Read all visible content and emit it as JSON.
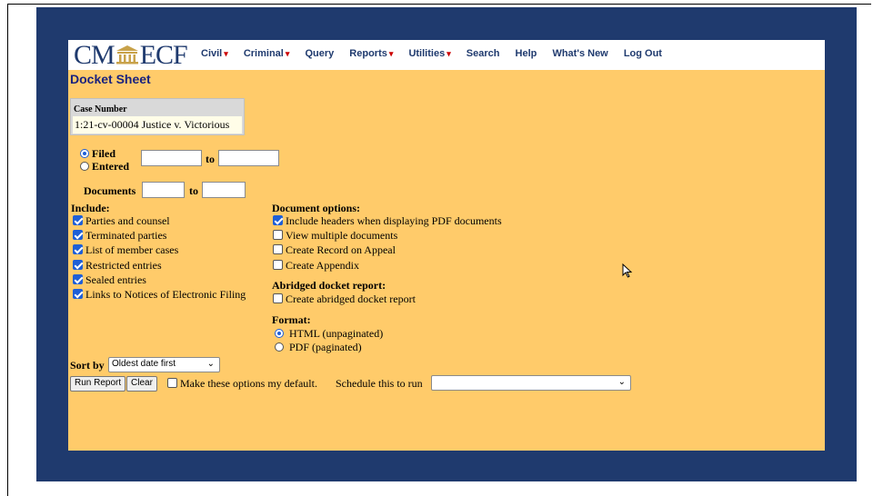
{
  "header": {
    "logo_left": "CM",
    "logo_right": "ECF",
    "menu": [
      {
        "label": "Civil",
        "dropdown": true
      },
      {
        "label": "Criminal",
        "dropdown": true
      },
      {
        "label": "Query",
        "dropdown": false
      },
      {
        "label": "Reports",
        "dropdown": true
      },
      {
        "label": "Utilities",
        "dropdown": true
      },
      {
        "label": "Search",
        "dropdown": false
      },
      {
        "label": "Help",
        "dropdown": false
      },
      {
        "label": "What's New",
        "dropdown": false
      },
      {
        "label": "Log Out",
        "dropdown": false
      }
    ]
  },
  "page_title": "Docket Sheet",
  "case": {
    "label": "Case Number",
    "value": "1:21-cv-00004 Justice v. Victorious"
  },
  "dates": {
    "filed_label": "Filed",
    "entered_label": "Entered",
    "to_label": "to",
    "filed_selected": true
  },
  "documents": {
    "label": "Documents",
    "to_label": "to"
  },
  "include": {
    "heading": "Include:",
    "items": [
      {
        "label": "Parties and counsel",
        "checked": true
      },
      {
        "label": "Terminated parties",
        "checked": true
      },
      {
        "label": "List of member cases",
        "checked": true
      },
      {
        "label": "Restricted entries",
        "checked": true
      },
      {
        "label": "Sealed entries",
        "checked": true
      },
      {
        "label": "Links to Notices of Electronic Filing",
        "checked": true
      }
    ]
  },
  "document_options": {
    "heading": "Document options:",
    "items": [
      {
        "label": "Include headers when displaying PDF documents",
        "checked": true
      },
      {
        "label": "View multiple documents",
        "checked": false
      },
      {
        "label": "Create Record on Appeal",
        "checked": false
      },
      {
        "label": "Create Appendix",
        "checked": false
      }
    ]
  },
  "abridged": {
    "heading": "Abridged docket report:",
    "label": "Create abridged docket report",
    "checked": false
  },
  "format": {
    "heading": "Format:",
    "options": [
      {
        "label": "HTML (unpaginated)",
        "selected": true
      },
      {
        "label": "PDF (paginated)",
        "selected": false
      }
    ]
  },
  "sort": {
    "label": "Sort by",
    "value": "Oldest date first"
  },
  "actions": {
    "run_label": "Run Report",
    "clear_label": "Clear",
    "default_label": "Make these options my default.",
    "schedule_label": "Schedule this to run",
    "schedule_value": ""
  },
  "colors": {
    "navy": "#1f3a6e",
    "page_bg": "#ffcb6a",
    "accent_blue": "#1e5fd6"
  }
}
